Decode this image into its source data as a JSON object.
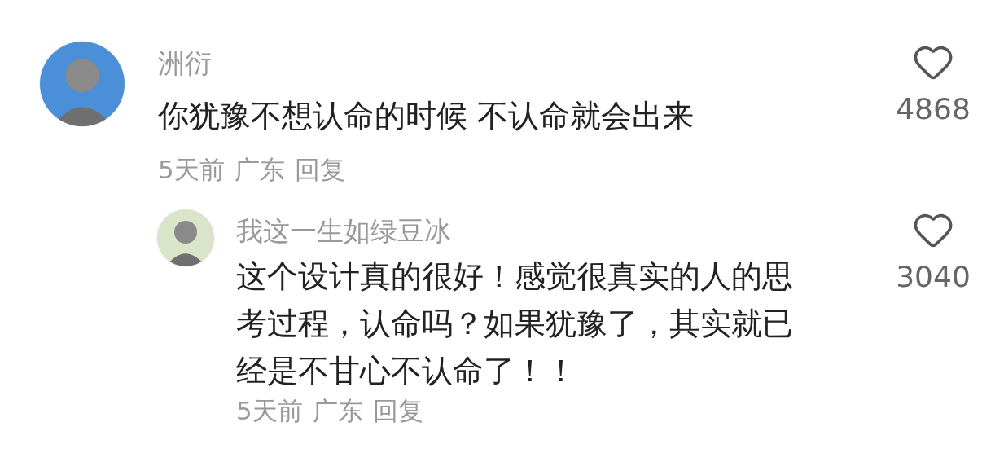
{
  "comments": [
    {
      "author": "洲衍",
      "text": "你犹豫不想认命的时候 不认命就会出来",
      "time": "5天前",
      "location": "广东",
      "reply_label": "回复",
      "likes": "4868",
      "replies": [
        {
          "author": "我这一生如绿豆冰",
          "text": "这个设计真的很好！感觉很真实的人的思考过程，认命吗？如果犹豫了，其实就已经是不甘心不认命了！！",
          "time": "5天前",
          "location": "广东",
          "reply_label": "回复",
          "likes": "3040"
        }
      ]
    }
  ]
}
